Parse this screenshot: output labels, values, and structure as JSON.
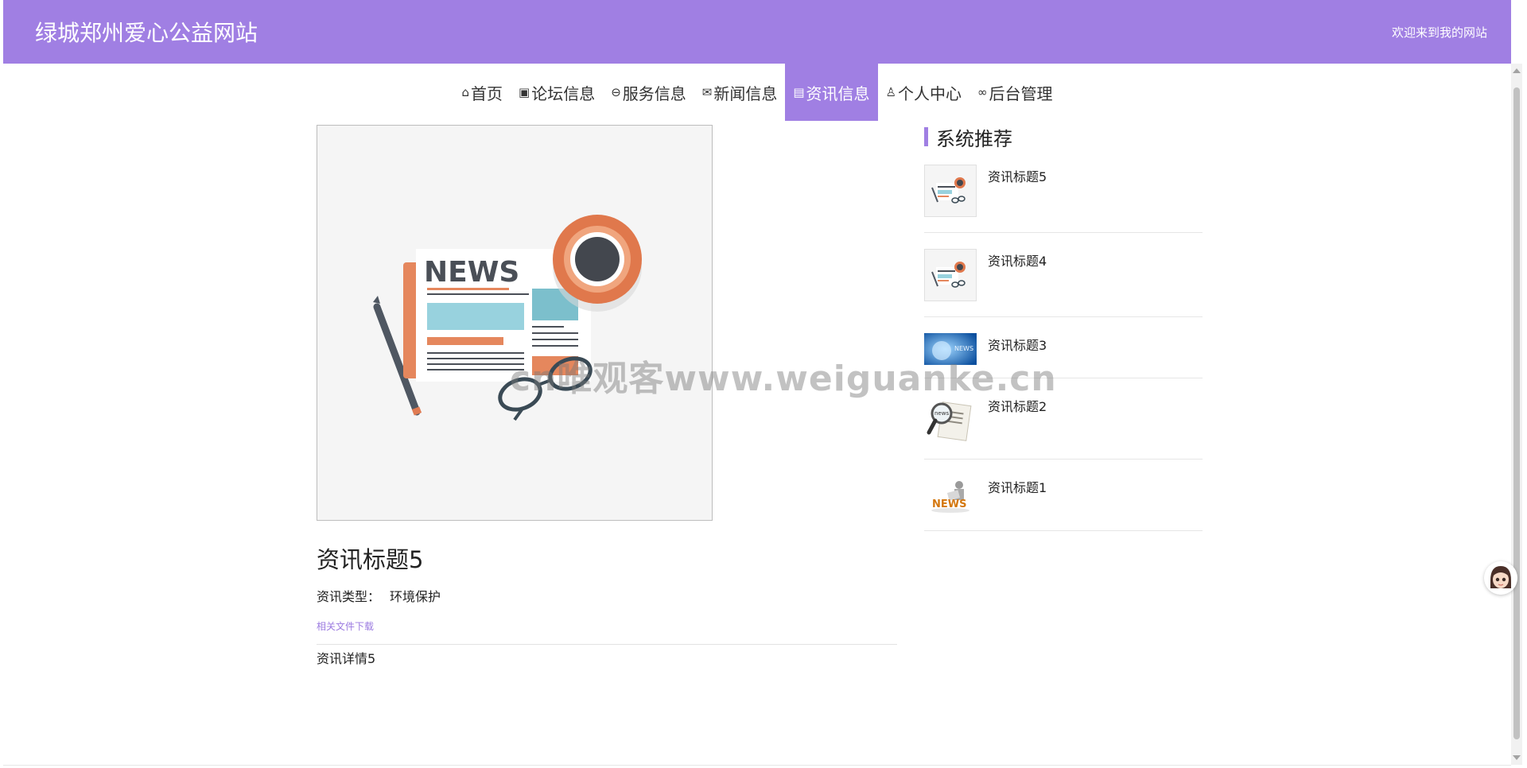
{
  "header": {
    "site_title": "绿城郑州爱心公益网站",
    "welcome": "欢迎来到我的网站"
  },
  "nav": [
    {
      "icon": "home-icon",
      "glyph": "⌂",
      "label": "首页",
      "active": false
    },
    {
      "icon": "forum-icon",
      "glyph": "▣",
      "label": "论坛信息",
      "active": false
    },
    {
      "icon": "service-icon",
      "glyph": "⊖",
      "label": "服务信息",
      "active": false
    },
    {
      "icon": "mail-icon",
      "glyph": "✉",
      "label": "新闻信息",
      "active": false
    },
    {
      "icon": "news-icon",
      "glyph": "▤",
      "label": "资讯信息",
      "active": true
    },
    {
      "icon": "user-icon",
      "glyph": "♙",
      "label": "个人中心",
      "active": false
    },
    {
      "icon": "link-icon",
      "glyph": "∞",
      "label": "后台管理",
      "active": false
    }
  ],
  "article": {
    "hero_image_text": "NEWS",
    "title": "资讯标题5",
    "type_label": "资讯类型：",
    "type_value": "环境保护",
    "download": "相关文件下载",
    "detail": "资讯详情5"
  },
  "sidebar": {
    "title": "系统推荐",
    "items": [
      {
        "label": "资讯标题5",
        "thumb": "newspaper-illustration"
      },
      {
        "label": "资讯标题4",
        "thumb": "newspaper-illustration"
      },
      {
        "label": "资讯标题3",
        "thumb": "blue-news-banner"
      },
      {
        "label": "资讯标题2",
        "thumb": "magnifier-newspaper"
      },
      {
        "label": "资讯标题1",
        "thumb": "news-3d-figure"
      }
    ]
  },
  "watermark": "cn唯观客www.weiguanke.cn",
  "colors": {
    "accent": "#a07fe3",
    "link": "#9b7ae0"
  }
}
